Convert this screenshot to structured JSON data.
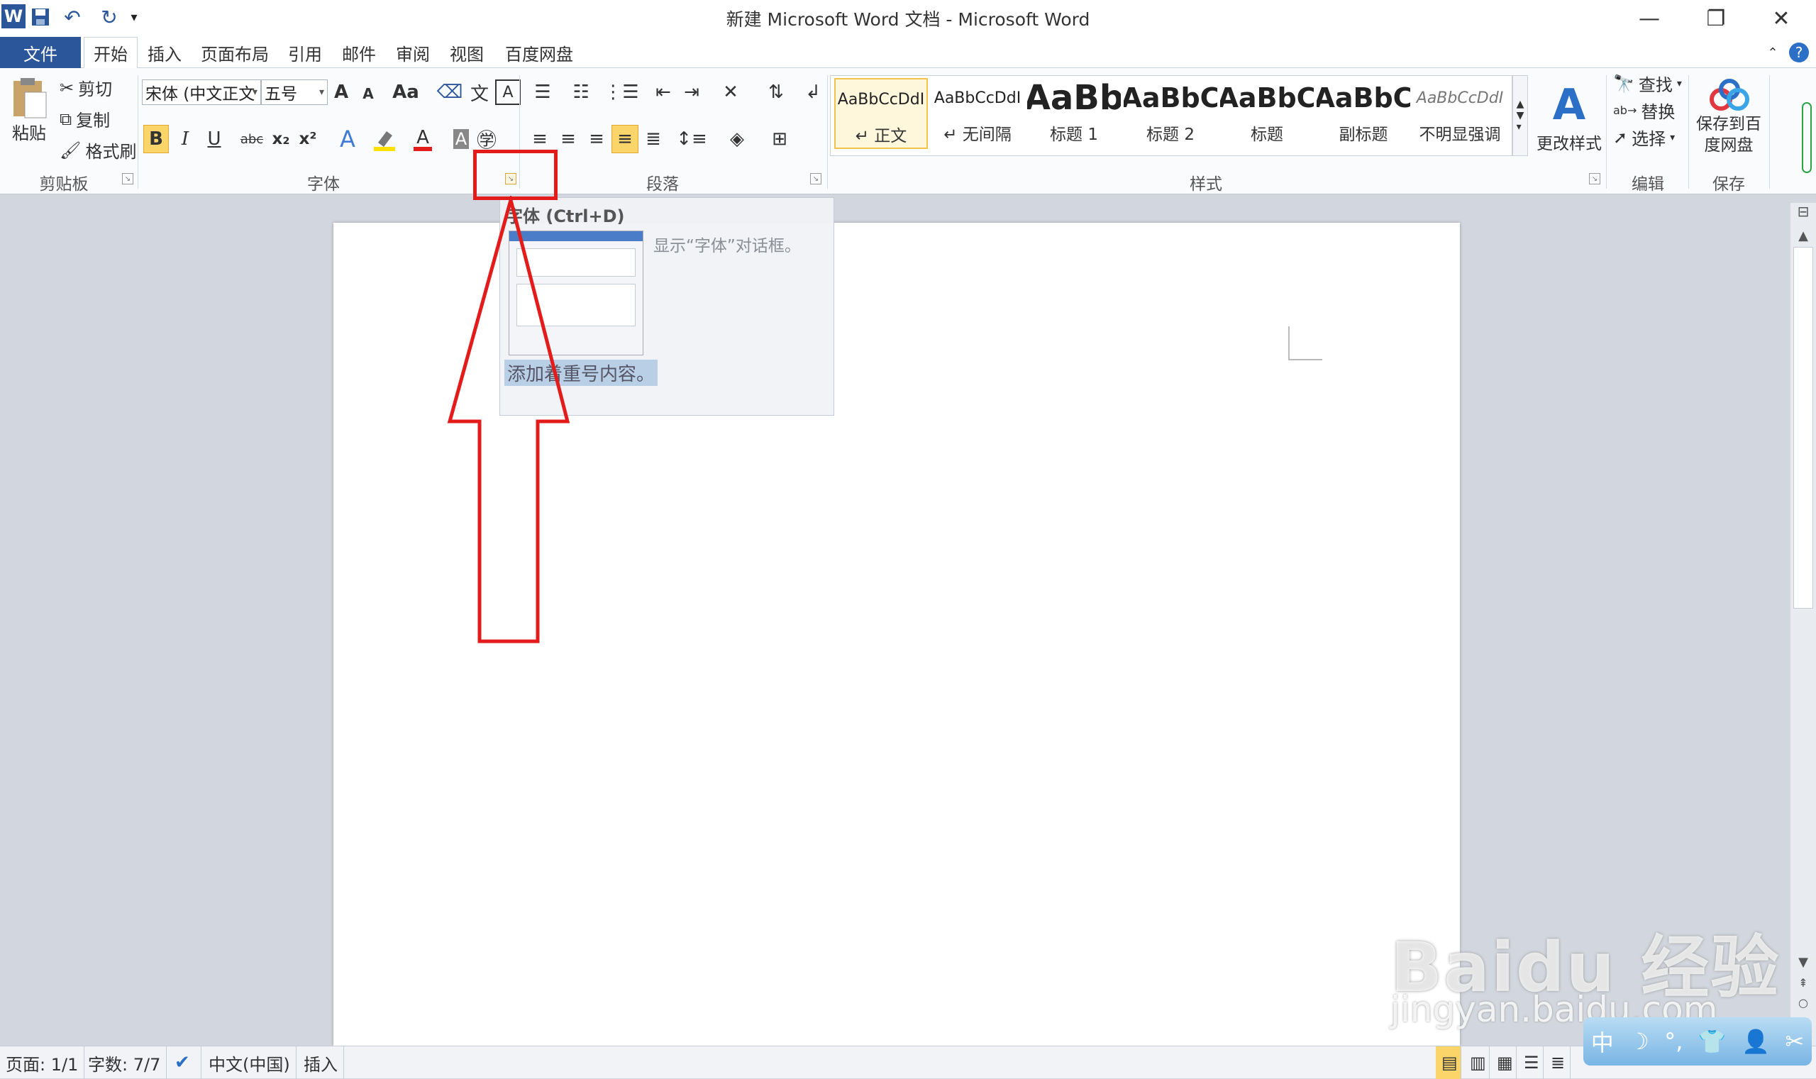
{
  "window": {
    "title": "新建 Microsoft Word 文档 - Microsoft Word",
    "quick_access": {
      "app_icon": "W",
      "save_icon": "floppy-icon",
      "undo_icon": "undo-icon",
      "redo_icon": "redo-icon",
      "customize_icon": "dropdown-icon"
    },
    "controls": {
      "minimize": "—",
      "restore": "❐",
      "close": "✕"
    }
  },
  "tabs": {
    "file": "文件",
    "items": [
      "开始",
      "插入",
      "页面布局",
      "引用",
      "邮件",
      "审阅",
      "视图",
      "百度网盘"
    ],
    "active": "开始"
  },
  "ribbon": {
    "clipboard": {
      "label": "剪贴板",
      "paste": "粘贴",
      "cut": "剪切",
      "copy": "复制",
      "format_painter": "格式刷"
    },
    "font": {
      "label": "字体",
      "font_name": "宋体 (中文正文",
      "font_size": "五号",
      "grow": "A",
      "shrink": "A",
      "change_case": "Aa",
      "bold": "B",
      "italic": "I",
      "underline": "U",
      "strikethrough": "abc",
      "subscript": "x₂",
      "superscript": "x²",
      "font_color_accent": "#e31b1b",
      "highlight_color": "#ffe000"
    },
    "paragraph": {
      "label": "段落"
    },
    "styles": {
      "label": "样式",
      "items": [
        {
          "sample": "AaBbCcDdI",
          "name": "↵ 正文"
        },
        {
          "sample": "AaBbCcDdI",
          "name": "↵ 无间隔"
        },
        {
          "sample": "AaBb",
          "name": "标题 1"
        },
        {
          "sample": "AaBbC",
          "name": "标题 2"
        },
        {
          "sample": "AaBbC",
          "name": "标题"
        },
        {
          "sample": "AaBbC",
          "name": "副标题"
        },
        {
          "sample": "AaBbCcDdI",
          "name": "不明显强调"
        }
      ],
      "change_styles": "更改样式"
    },
    "editing": {
      "label": "编辑",
      "find": "查找",
      "replace": "替换",
      "select": "选择"
    },
    "save": {
      "label": "保存",
      "button": "保存到百度网盘"
    }
  },
  "tooltip": {
    "title": "字体 (Ctrl+D)",
    "description": "显示“字体”对话框。",
    "highlighted_text": "添加着重号内容。"
  },
  "statusbar": {
    "page": "页面: 1/1",
    "words": "字数: 7/7",
    "language": "中文(中国)",
    "mode": "插入"
  },
  "watermark": {
    "brand": "Baidu 经验",
    "url": "jingyan.baidu.com"
  },
  "ime": {
    "mode": "中"
  },
  "colors": {
    "file_tab": "#2b579a",
    "annotation": "#e31b1b",
    "selection": "#b9cfe6"
  }
}
